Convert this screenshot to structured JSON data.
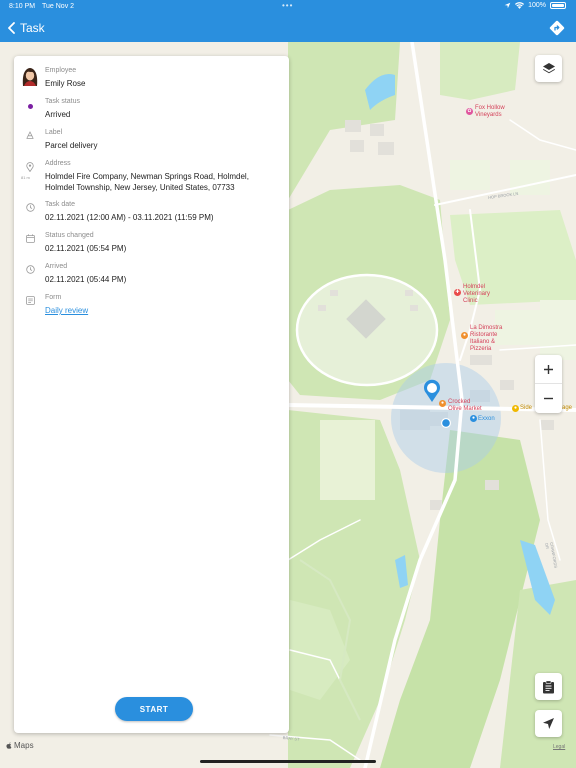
{
  "status_bar": {
    "time": "8:10 PM",
    "date": "Tue Nov 2",
    "battery": "100%"
  },
  "app_bar": {
    "title": "Task"
  },
  "task": {
    "employee": {
      "label": "Employee",
      "value": "Emily Rose"
    },
    "status": {
      "label": "Task status",
      "value": "Arrived",
      "color": "#7b1fa2"
    },
    "label": {
      "label": "Label",
      "value": "Parcel delivery"
    },
    "address": {
      "label": "Address",
      "distance": "81 m",
      "value": "Holmdel Fire Company, Newman Springs Road, Holmdel, Holmdel Township, New Jersey, United States, 07733"
    },
    "task_date": {
      "label": "Task date",
      "value": "02.11.2021 (12:00 AM) - 03.11.2021 (11:59 PM)"
    },
    "status_changed": {
      "label": "Status changed",
      "value": "02.11.2021 (05:54 PM)"
    },
    "arrived": {
      "label": "Arrived",
      "value": "02.11.2021 (05:44 PM)"
    },
    "form": {
      "label": "Form",
      "value": "Daily review"
    },
    "start_label": "START"
  },
  "map": {
    "pois": {
      "fox_hollow": "Fox Hollow\nVineyards",
      "holmdel_vet": "Holmdel\nVeterinary\nClinic",
      "la_dimostra": "La Dimostra\nRistorante\nItaliano &\nPizzeria",
      "crocked_olive": "Crocked\nOlive Market",
      "exxon": "Exxon",
      "side_garage": "Side",
      "garage_suffix": "age"
    },
    "roads": {
      "hop_brook": "HOP BROOK LN",
      "crawfords": "CRAWFORDS DR",
      "bray": "BRAY ST"
    },
    "attribution": "Maps",
    "legal": "Legal"
  },
  "colors": {
    "accent": "#2a8fde",
    "water": "#8fd3f4",
    "park": "#cfe6b4",
    "land": "#f2efe6"
  }
}
